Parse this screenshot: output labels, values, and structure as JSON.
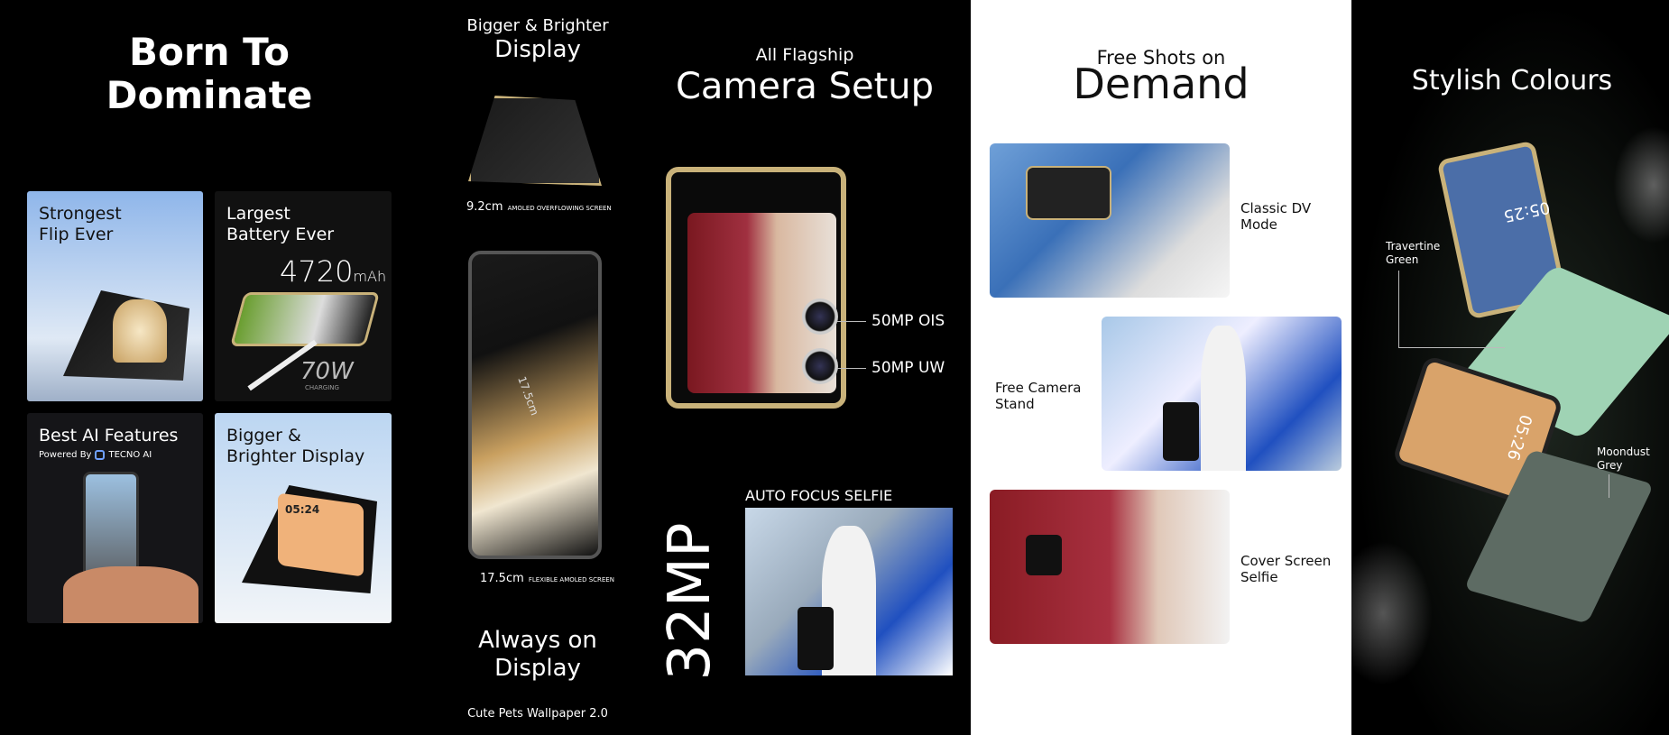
{
  "panel1": {
    "title": "Born To\nDominate",
    "tiles": [
      {
        "title": "Strongest\nFlip Ever"
      },
      {
        "title": "Largest\nBattery Ever",
        "battery": "4720",
        "battery_unit": "mAh",
        "charging": "70W",
        "charging_label": "CHARGING"
      },
      {
        "title": "Best AI Features",
        "powered_by": "Powered By",
        "brand": "TECNO AI"
      },
      {
        "title": "Bigger &\nBrighter Display",
        "clock": "05:24"
      }
    ]
  },
  "panel2": {
    "heading_small": "Bigger & Brighter",
    "heading_large": "Display",
    "small_screen_size": "9.2cm",
    "small_screen_desc": "AMOLED OVERFLOWING SCREEN",
    "big_screen_size": "17.5cm",
    "big_screen_desc": "FLEXIBLE AMOLED SCREEN",
    "big_screen_diag": "17.5cm",
    "aod_title": "Always on\nDisplay",
    "aod_subtitle": "Cute Pets Wallpaper 2.0"
  },
  "panel3": {
    "heading_small": "All Flagship",
    "heading_large": "Camera Setup",
    "camera1": "50MP OIS",
    "camera2": "50MP UW",
    "selfie_label": "AUTO FOCUS SELFIE",
    "selfie_mp": "32MP"
  },
  "panel4": {
    "heading_small": "Free Shots on",
    "heading_large": "Demand",
    "modes": [
      "Classic DV\nMode",
      "Free Camera\nStand",
      "Cover Screen\nSelfie"
    ]
  },
  "panel5": {
    "heading": "Stylish Colours",
    "colors": [
      {
        "name": "Travertine\nGreen",
        "clock": "05:25",
        "swatch": "#9fd3b4"
      },
      {
        "name": "Moondust\nGrey",
        "clock": "05:26",
        "swatch": "#5d6b63"
      }
    ]
  },
  "colors": {
    "gold": "#c9b27a",
    "white_panel": "#ffffff",
    "black_panel": "#000000"
  }
}
